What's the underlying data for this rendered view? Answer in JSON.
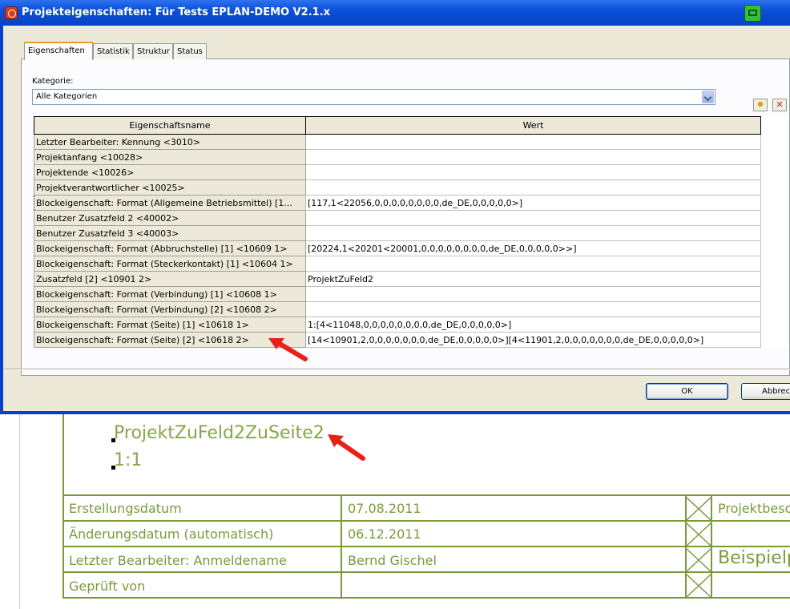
{
  "dialog": {
    "title": "Projekteigenschaften: Für Tests EPLAN-DEMO V2.1.x",
    "tabs": [
      "Eigenschaften",
      "Statistik",
      "Struktur",
      "Status"
    ],
    "active_tab": "Eigenschaften",
    "category_label": "Kategorie:",
    "category_value": "Alle Kategorien",
    "table": {
      "headers": [
        "Eigenschaftsname",
        "Wert"
      ],
      "rows": [
        {
          "name": "Letzter Bearbeiter: Kennung <3010>",
          "value": ""
        },
        {
          "name": "Projektanfang <10028>",
          "value": ""
        },
        {
          "name": "Projektende <10026>",
          "value": ""
        },
        {
          "name": "Projektverantwortlicher <10025>",
          "value": ""
        },
        {
          "name": "Blockeigenschaft: Format (Allgemeine Betriebsmittel) [1...",
          "value": "[117,1<22056,0,0,0,0,0,0,0,0,de_DE,0,0,0,0,0>]"
        },
        {
          "name": "Benutzer Zusatzfeld 2 <40002>",
          "value": ""
        },
        {
          "name": "Benutzer Zusatzfeld 3 <40003>",
          "value": ""
        },
        {
          "name": "Blockeigenschaft: Format (Abbruchstelle) [1] <10609 1>",
          "value": "[20224,1<20201<20001,0,0,0,0,0,0,0,0,de_DE,0,0,0,0,0>>]"
        },
        {
          "name": "Blockeigenschaft: Format (Steckerkontakt) [1] <10604 1>",
          "value": ""
        },
        {
          "name": "Zusatzfeld [2] <10901 2>",
          "value": "ProjektZuFeld2"
        },
        {
          "name": "Blockeigenschaft: Format (Verbindung) [1] <10608 1>",
          "value": ""
        },
        {
          "name": "Blockeigenschaft: Format (Verbindung) [2] <10608 2>",
          "value": ""
        },
        {
          "name": "Blockeigenschaft: Format (Seite) [1] <10618 1>",
          "value": "1:[4<11048,0,0,0,0,0,0,0,0,de_DE,0,0,0,0,0>]"
        },
        {
          "name": "Blockeigenschaft: Format (Seite) [2] <10618 2>",
          "value": "[14<10901,2,0,0,0,0,0,0,0,de_DE,0,0,0,0,0>][4<11901,2,0,0,0,0,0,0,0,de_DE,0,0,0,0,0>]"
        }
      ]
    },
    "ok_label": "OK",
    "cancel_label": "Abbrech",
    "icons": {
      "new_row": "new-star-icon",
      "delete_row": "delete-x-icon",
      "title_app": "eplan-app-icon",
      "title_button": "window-restore-icon"
    }
  },
  "drawing": {
    "text_1": "ProjektZuFeld2ZuSeite2",
    "text_2": "1:1",
    "title_block": [
      {
        "label": "Erstellungsdatum",
        "value": "07.08.2011",
        "right": "Projektbesc"
      },
      {
        "label": "Änderungsdatum (automatisch)",
        "value": "06.12.2011",
        "right": ""
      },
      {
        "label": "Letzter Bearbeiter: Anmeldename",
        "value": "Bernd Gischel",
        "right": "Beispielp"
      },
      {
        "label": "Geprüft von",
        "value": "",
        "right": ""
      }
    ],
    "accent_color": "#7a9a3a",
    "arrow_color": "#e8201a"
  }
}
